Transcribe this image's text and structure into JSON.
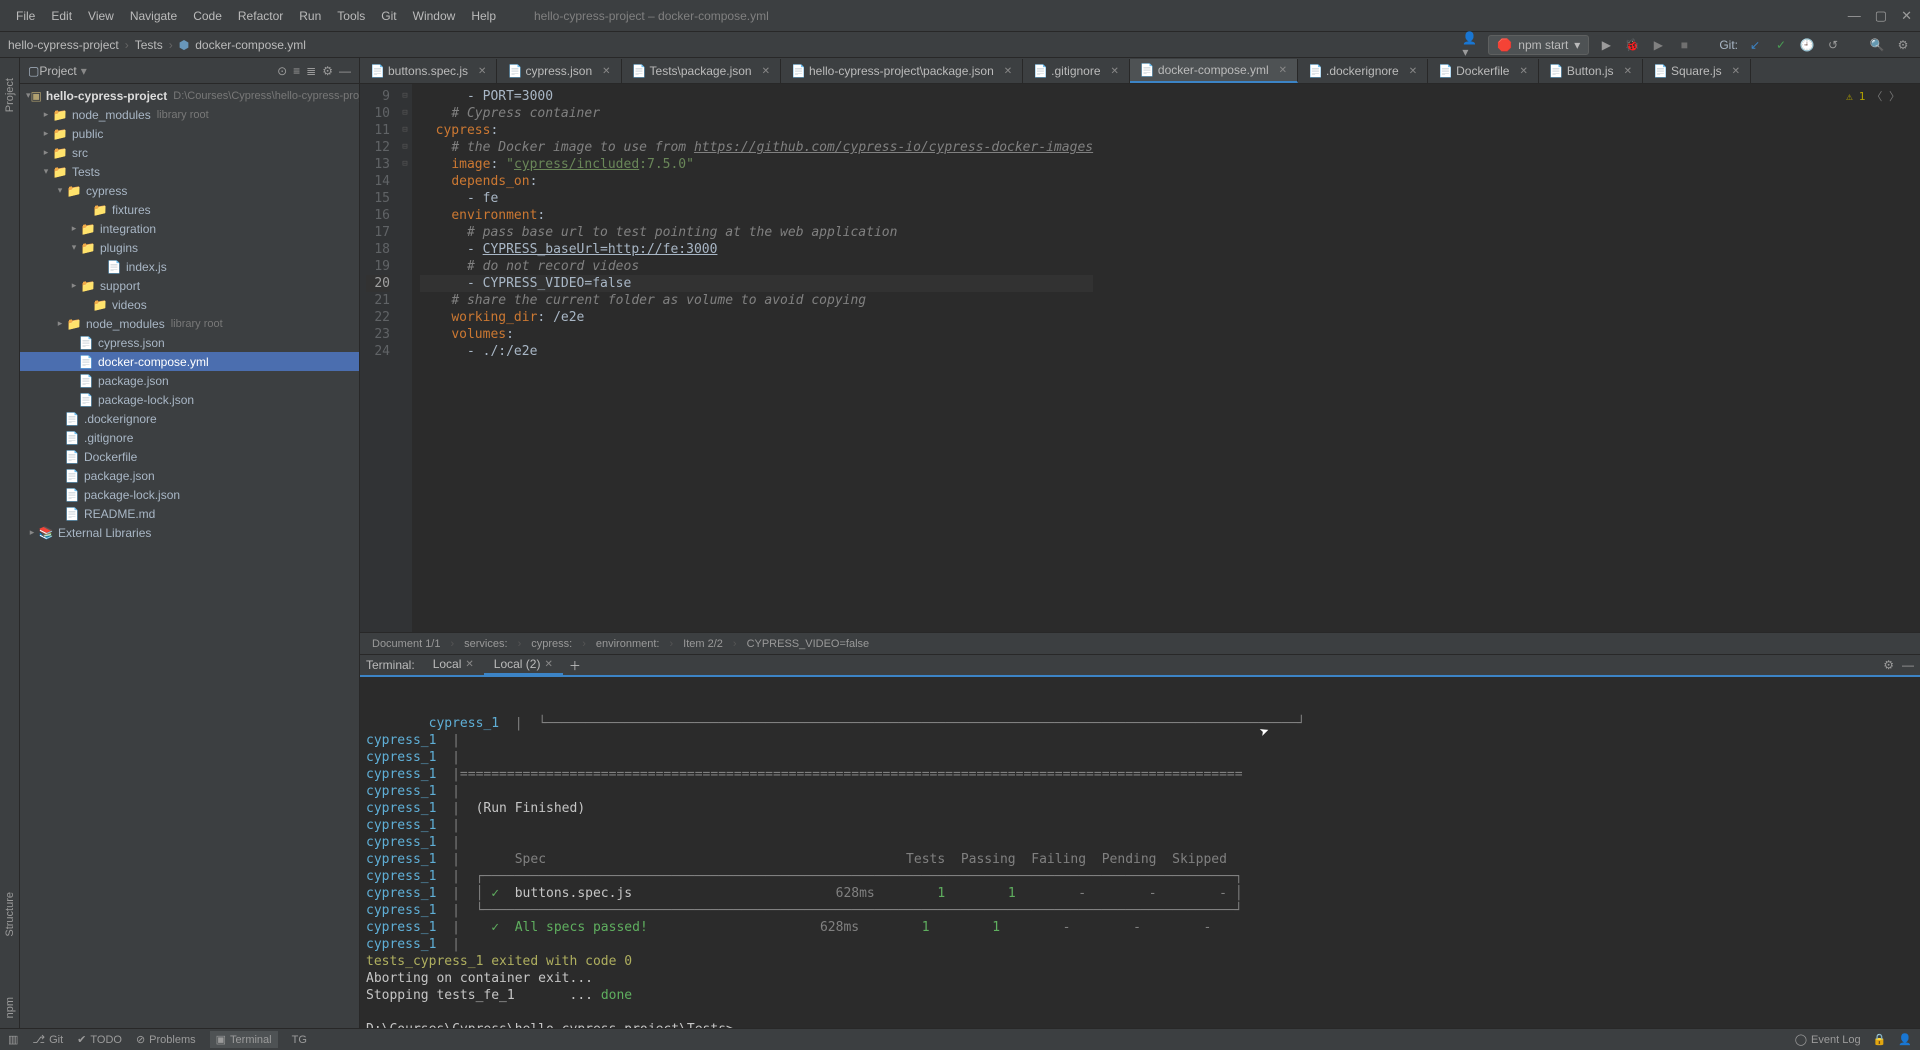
{
  "menu": [
    "File",
    "Edit",
    "View",
    "Navigate",
    "Code",
    "Refactor",
    "Run",
    "Tools",
    "Git",
    "Window",
    "Help"
  ],
  "window_title": "hello-cypress-project – docker-compose.yml",
  "breadcrumb": [
    "hello-cypress-project",
    "Tests",
    "docker-compose.yml"
  ],
  "run_config": "npm start",
  "git_label": "Git:",
  "sidebar": {
    "title": "Project",
    "tree": {
      "root": {
        "name": "hello-cypress-project",
        "hint": "D:\\Courses\\Cypress\\hello-cypress-project"
      },
      "node_modules_top": {
        "name": "node_modules",
        "hint": "library root"
      },
      "public": "public",
      "src": "src",
      "tests": "Tests",
      "cypress": "cypress",
      "fixtures": "fixtures",
      "integration": "integration",
      "plugins": "plugins",
      "index_js": "index.js",
      "support": "support",
      "videos": "videos",
      "node_modules_tests": {
        "name": "node_modules",
        "hint": "library root"
      },
      "cypress_json": "cypress.json",
      "docker_compose": "docker-compose.yml",
      "package_json": "package.json",
      "package_lock": "package-lock.json",
      "dockerignore": ".dockerignore",
      "gitignore": ".gitignore",
      "dockerfile": "Dockerfile",
      "root_package_json": "package.json",
      "root_package_lock": "package-lock.json",
      "readme": "README.md",
      "external": "External Libraries"
    }
  },
  "tabs": [
    {
      "label": "buttons.spec.js",
      "active": false
    },
    {
      "label": "cypress.json",
      "active": false
    },
    {
      "label": "Tests\\package.json",
      "active": false
    },
    {
      "label": "hello-cypress-project\\package.json",
      "active": false
    },
    {
      "label": ".gitignore",
      "active": false
    },
    {
      "label": "docker-compose.yml",
      "active": true
    },
    {
      "label": ".dockerignore",
      "active": false
    },
    {
      "label": "Dockerfile",
      "active": false
    },
    {
      "label": "Button.js",
      "active": false
    },
    {
      "label": "Square.js",
      "active": false
    }
  ],
  "editor": {
    "warnings": "1",
    "line_start": 9,
    "current_line": 20,
    "lines": [
      {
        "n": 9,
        "indent": "      ",
        "type": "item",
        "text": "- PORT=3000"
      },
      {
        "n": 10,
        "indent": "    ",
        "type": "cmt",
        "text": "# Cypress container"
      },
      {
        "n": 11,
        "indent": "  ",
        "type": "key",
        "key": "cypress",
        "after": ":",
        "play": true
      },
      {
        "n": 12,
        "indent": "    ",
        "type": "cmt_url",
        "pre": "# the Docker image to use from ",
        "url": "https://github.com/cypress-io/cypress-docker-images"
      },
      {
        "n": 13,
        "indent": "    ",
        "type": "kv_str_u",
        "key": "image",
        "val_pre": "\"",
        "val_u": "cypress/included",
        "val_post": ":7.5.0\""
      },
      {
        "n": 14,
        "indent": "    ",
        "type": "key",
        "key": "depends_on",
        "after": ":"
      },
      {
        "n": 15,
        "indent": "      ",
        "type": "item",
        "text": "- fe"
      },
      {
        "n": 16,
        "indent": "    ",
        "type": "key",
        "key": "environment",
        "after": ":"
      },
      {
        "n": 17,
        "indent": "      ",
        "type": "cmt",
        "text": "# pass base url to test pointing at the web application"
      },
      {
        "n": 18,
        "indent": "      ",
        "type": "item_u",
        "pre": "- ",
        "u": "CYPRESS_baseUrl=http://fe:3000"
      },
      {
        "n": 19,
        "indent": "      ",
        "type": "cmt",
        "text": "# do not record videos"
      },
      {
        "n": 20,
        "indent": "      ",
        "type": "item",
        "text": "- CYPRESS_VIDEO=false",
        "hl": true
      },
      {
        "n": 21,
        "indent": "    ",
        "type": "cmt",
        "text": "# share the current folder as volume to avoid copying"
      },
      {
        "n": 22,
        "indent": "    ",
        "type": "kv",
        "key": "working_dir",
        "val": "/e2e"
      },
      {
        "n": 23,
        "indent": "    ",
        "type": "key",
        "key": "volumes",
        "after": ":"
      },
      {
        "n": 24,
        "indent": "      ",
        "type": "item",
        "text": "- ./:/e2e"
      }
    ]
  },
  "editor_breadcrumb": [
    "Document 1/1",
    "services:",
    "cypress:",
    "environment:",
    "Item 2/2",
    "CYPRESS_VIDEO=false"
  ],
  "terminal": {
    "title": "Terminal:",
    "tabs": [
      {
        "label": "Local",
        "active": false
      },
      {
        "label": "Local (2)",
        "active": true
      }
    ],
    "prefix": "cypress_1  ",
    "pipe": "|",
    "run_finished": "(Run Finished)",
    "headers": "       Spec                                              Tests  Passing  Failing  Pending  Skipped",
    "spec_row": {
      "check": "✓",
      "name": "buttons.spec.js",
      "time": "628ms",
      "cols": [
        "1",
        "1",
        "-",
        "-",
        "-"
      ]
    },
    "all_row": {
      "check": "✓",
      "name": "All specs passed!",
      "time": "628ms",
      "cols": [
        "1",
        "1",
        "-",
        "-",
        "-"
      ]
    },
    "exit": "tests_cypress_1 exited with code 0",
    "abort": "Aborting on container exit...",
    "stopping_pre": "Stopping tests_fe_1       ... ",
    "stopping_done": "done",
    "prompt": "D:\\Courses\\Cypress\\hello-cypress-project\\Tests>"
  },
  "statusbar": {
    "git": "Git",
    "todo": "TODO",
    "problems": "Problems",
    "terminal": "Terminal",
    "tg": "TG",
    "event_log": "Event Log"
  }
}
